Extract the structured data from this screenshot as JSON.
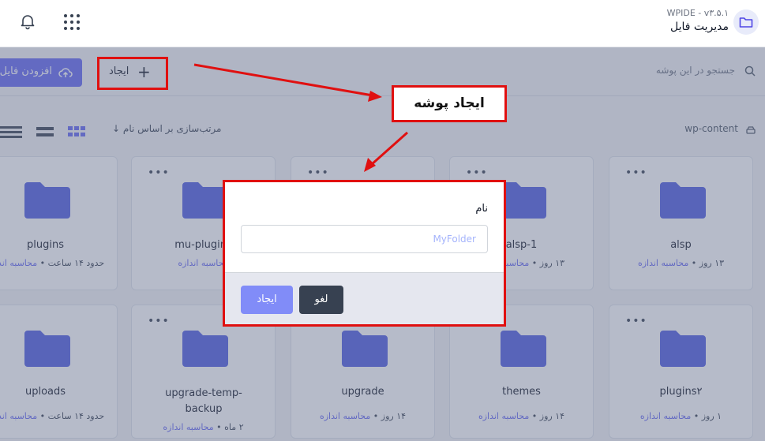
{
  "app": {
    "version": "WPIDE - v۳.۵.۱",
    "title": "مدیریت فایل",
    "icons": [
      "folder-icon",
      "bell-icon",
      "apps-grid-icon"
    ]
  },
  "toolbar": {
    "upload_label": "افزودن فایل",
    "create_label": "ایجاد",
    "search_placeholder": "جستجو در این پوشه"
  },
  "breadcrumb": {
    "path": "wp-content"
  },
  "sort": {
    "label": "مرتب‌سازی بر اساس نام"
  },
  "cards": [
    {
      "name": "alsp",
      "age": "۱۳ روز",
      "size": "محاسبه اندازه"
    },
    {
      "name": "alsp-1",
      "age": "۱۳ روز",
      "size": "محاسبه اندازه"
    },
    {
      "name": "",
      "age": "",
      "size": ""
    },
    {
      "name": "mu-plugins",
      "age": "",
      "size": "محاسبه اندازه"
    },
    {
      "name": "plugins",
      "age": "حدود ۱۴ ساعت",
      "size": "محاسبه اندازه"
    },
    {
      "name": "plugins۲",
      "age": "۱ روز",
      "size": "محاسبه اندازه"
    },
    {
      "name": "themes",
      "age": "۱۴ روز",
      "size": "محاسبه اندازه"
    },
    {
      "name": "upgrade",
      "age": "۱۴ روز",
      "size": "محاسبه اندازه"
    },
    {
      "name": "upgrade-temp-backup",
      "age": "۲ ماه",
      "size": "محاسبه اندازه"
    },
    {
      "name": "uploads",
      "age": "حدود ۱۴ ساعت",
      "size": "محاسبه اندازه"
    }
  ],
  "modal": {
    "field_label": "نام",
    "input_placeholder": "MyFolder",
    "create_label": "ایجاد",
    "cancel_label": "لغو"
  },
  "annotation": {
    "callout_text": "ایجاد پوشه"
  },
  "colors": {
    "accent": "#6366f1",
    "highlight": "#e01010",
    "dark_button": "#374151"
  }
}
